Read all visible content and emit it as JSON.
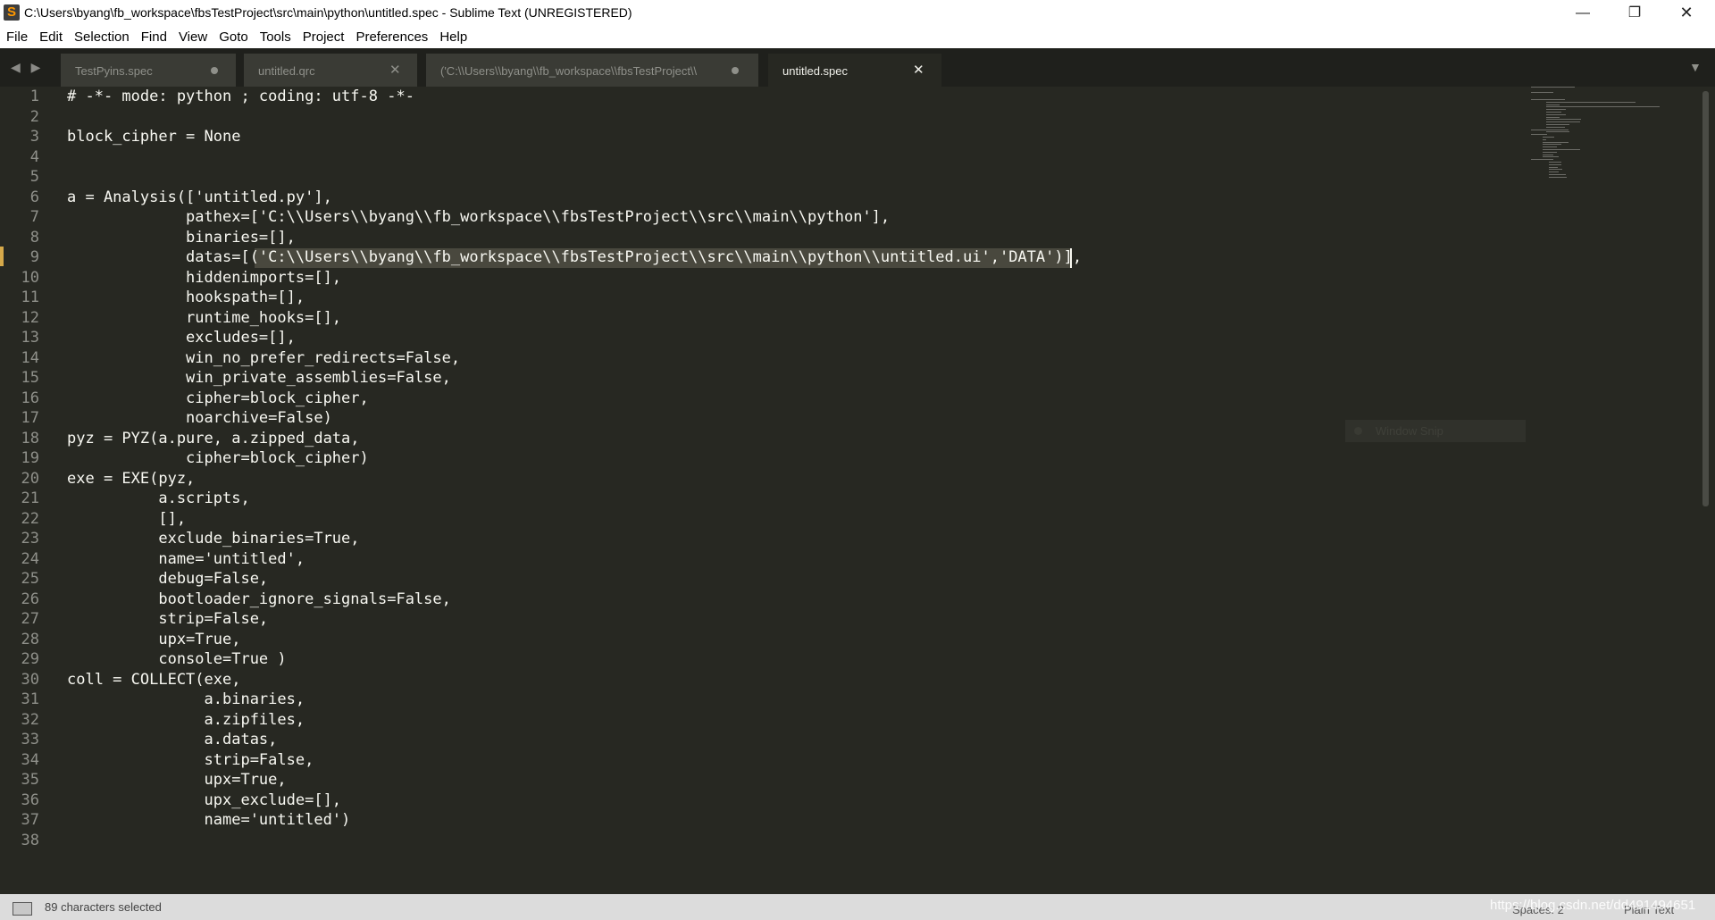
{
  "window": {
    "title": "C:\\Users\\byang\\fb_workspace\\fbsTestProject\\src\\main\\python\\untitled.spec - Sublime Text (UNREGISTERED)",
    "minimize_glyph": "—",
    "maximize_glyph": "❐",
    "close_glyph": "✕"
  },
  "menu": [
    "File",
    "Edit",
    "Selection",
    "Find",
    "View",
    "Goto",
    "Tools",
    "Project",
    "Preferences",
    "Help"
  ],
  "tabs": [
    {
      "label": "TestPyins.spec",
      "state": "modified"
    },
    {
      "label": "untitled.qrc",
      "state": "close"
    },
    {
      "label": "('C:\\\\Users\\\\byang\\\\fb_workspace\\\\fbsTestProject\\\\",
      "state": "modified"
    },
    {
      "label": "untitled.spec",
      "state": "close",
      "active": true
    }
  ],
  "tab_close_glyph": "✕",
  "nav_arrows": "◀ ▶",
  "tab_list_glyph": "▼",
  "editor": {
    "lines": [
      "# -*- mode: python ; coding: utf-8 -*-",
      "",
      "block_cipher = None",
      "",
      "",
      "a = Analysis(['untitled.py'],",
      "             pathex=['C:\\\\Users\\\\byang\\\\fb_workspace\\\\fbsTestProject\\\\src\\\\main\\\\python'],",
      "             binaries=[],",
      "             datas=[('C:\\\\Users\\\\byang\\\\fb_workspace\\\\fbsTestProject\\\\src\\\\main\\\\python\\\\untitled.ui','DATA')],",
      "             hiddenimports=[],",
      "             hookspath=[],",
      "             runtime_hooks=[],",
      "             excludes=[],",
      "             win_no_prefer_redirects=False,",
      "             win_private_assemblies=False,",
      "             cipher=block_cipher,",
      "             noarchive=False)",
      "pyz = PYZ(a.pure, a.zipped_data,",
      "             cipher=block_cipher)",
      "exe = EXE(pyz,",
      "          a.scripts,",
      "          [],",
      "          exclude_binaries=True,",
      "          name='untitled',",
      "          debug=False,",
      "          bootloader_ignore_signals=False,",
      "          strip=False,",
      "          upx=True,",
      "          console=True )",
      "coll = COLLECT(exe,",
      "               a.binaries,",
      "               a.zipfiles,",
      "               a.datas,",
      "               strip=False,",
      "               upx=True,",
      "               upx_exclude=[],",
      "               name='untitled')",
      ""
    ],
    "active_line": 9,
    "ghost_label": "Window Snip"
  },
  "status": {
    "selection": "89 characters selected",
    "spaces": "Spaces: 2",
    "syntax": "Plain Text",
    "watermark": "https://blog.csdn.net/dd491494651"
  }
}
